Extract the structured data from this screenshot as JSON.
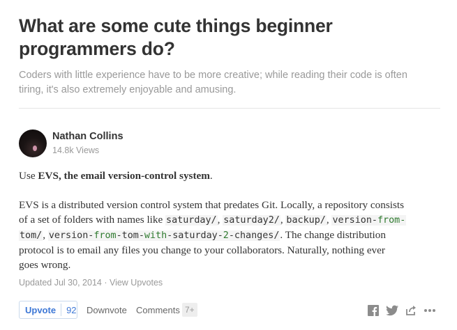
{
  "question": {
    "title_lines": [
      "What are some cute things beginner",
      "programmers do?"
    ],
    "details_lines": [
      "Coders with little experience have to be more creative; while reading their code is often",
      "tiring, it's also extremely enjoyable and amusing."
    ]
  },
  "author": {
    "name": "Nathan Collins",
    "views": "14.8k Views"
  },
  "answer": {
    "p1": {
      "prefix": "Use ",
      "bold": "EVS, the email version-control system",
      "suffix": "."
    },
    "p2": {
      "line1": "EVS is a distributed version control system that predates Git.  Locally, a repository consists",
      "line2_prefix": "of a set of folders with names like ",
      "code_saturday": "saturday/",
      "comma1": ", ",
      "code_saturday2": "saturday2/",
      "comma2": ", ",
      "code_backup": "backup/",
      "comma3": ", ",
      "code_vft_a": "version-",
      "code_vft_b": "from-",
      "code_tom_a": "tom/",
      "comma4": ", ",
      "code_long_a": "version-",
      "code_long_b": "from",
      "code_long_c": "-tom-",
      "code_long_d": "with",
      "code_long_e": "-saturday-",
      "code_long_f": "2",
      "code_long_g": "-changes/",
      "line3_suffix": ". The change distribution",
      "line4": "protocol is to email any files you change to your collaborators.  Naturally, nothing ever",
      "line5": "goes wrong."
    }
  },
  "meta": {
    "updated": "Updated Jul 30, 2014",
    "separator": " · ",
    "view_upvotes": "View Upvotes"
  },
  "actions": {
    "upvote_label": "Upvote",
    "upvote_count": "92",
    "downvote_label": "Downvote",
    "comments_label": "Comments",
    "comments_count": "7+"
  },
  "icons": {
    "facebook": "facebook-icon",
    "twitter": "twitter-icon",
    "share": "share-icon",
    "more": "more-icon"
  },
  "colors": {
    "accent": "#3e78d6",
    "code_highlight": "#2f7a2f",
    "muted": "#999999",
    "text": "#333333"
  }
}
